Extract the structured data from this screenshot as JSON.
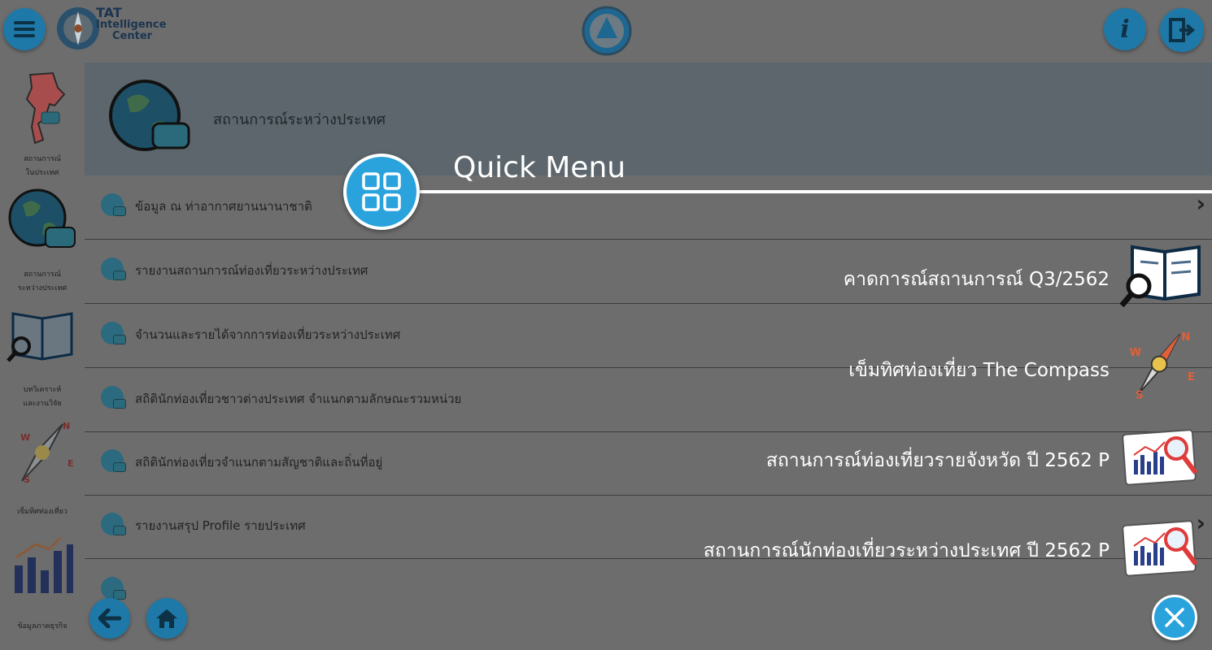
{
  "app": {
    "logo_line1": "TAT",
    "logo_line2": "Intelligence",
    "logo_line3": "Center"
  },
  "sidebar": {
    "items": [
      {
        "label_line1": "สถานการณ์",
        "label_line2": "ในประเทศ"
      },
      {
        "label_line1": "สถานการณ์",
        "label_line2": "ระหว่างประเทศ"
      },
      {
        "label_line1": "บทวิเคราะห์",
        "label_line2": "และงานวิจัย"
      },
      {
        "label_line1": "เข็มทิศท่องเที่ยว",
        "label_line2": ""
      },
      {
        "label_line1": "ข้อมูลภาคธุรกิจ",
        "label_line2": ""
      }
    ]
  },
  "header": {
    "title": "สถานการณ์ระหว่างประเทศ"
  },
  "list": {
    "rows": [
      {
        "label": "ข้อมูล ณ ท่าอากาศยานนานาชาติ"
      },
      {
        "label": "รายงานสถานการณ์ท่องเที่ยวระหว่างประเทศ"
      },
      {
        "label": "จำนวนและรายได้จากการท่องเที่ยวระหว่างประเทศ"
      },
      {
        "label": "สถิตินักท่องเที่ยวชาวต่างประเทศ จำแนกตามลักษณะรวมหน่วย"
      },
      {
        "label": "สถิตินักท่องเที่ยวจำแนกตามสัญชาติและถิ่นที่อยู่"
      },
      {
        "label": "รายงานสรุป Profile รายประเทศ"
      }
    ]
  },
  "quick_menu": {
    "title": "Quick Menu",
    "items": [
      {
        "label": "คาดการณ์สถานการณ์ Q3/2562",
        "icon": "book-magnifier-icon"
      },
      {
        "label": "เข็มทิศท่องเที่ยว The Compass",
        "icon": "compass-icon"
      },
      {
        "label": "สถานการณ์ท่องเที่ยวรายจังหวัด ปี 2562 P",
        "icon": "report-chart-icon"
      },
      {
        "label": "สถานการณ์นักท่องเที่ยวระหว่างประเทศ ปี 2562 P",
        "icon": "report-chart-icon"
      }
    ]
  },
  "colors": {
    "overlay_bg": "#6d6d6d",
    "accent": "#2aa3dc",
    "button_blue": "#1f79a8"
  }
}
